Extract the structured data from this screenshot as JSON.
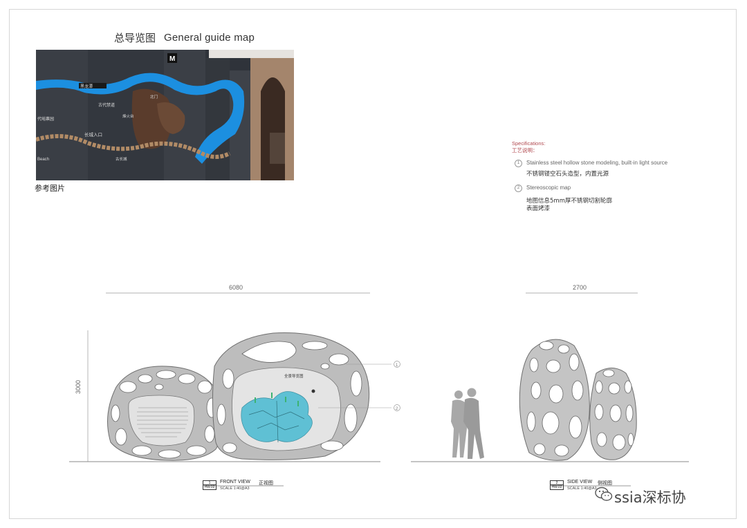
{
  "header": {
    "title_cn": "总导览图",
    "title_en": "General guide map"
  },
  "reference_photo": {
    "caption": "参考图片",
    "sign_labels": [
      "黑龙潭",
      "古代禁道",
      "代峪禀园",
      "长城入口",
      "Beach",
      "古长城",
      "北门",
      "烽火台"
    ],
    "colors": {
      "water": "#1c8fe0",
      "panel": "#33373e",
      "wall": "#a07a5e"
    }
  },
  "specifications": {
    "heading_en": "Specifications:",
    "heading_cn": "工艺说明：",
    "items": [
      {
        "num": "1",
        "text_en": "Stainless steel hollow stone modeling, built-in light source",
        "text_cn": [
          "不锈钢镂空石头造型，内置光源"
        ]
      },
      {
        "num": "2",
        "text_en": "Stereoscopic map",
        "text_cn": [
          "地图信息5mm厚不锈钢切割轮廓",
          "表面烤漆"
        ]
      }
    ]
  },
  "front_view": {
    "width_dim": "6080",
    "height_dim": "3000",
    "callouts": [
      "1",
      "2"
    ],
    "map_title": "全景导览图",
    "label_num": "1",
    "label_code": "HW.02",
    "label_en": "FRONT VIEW",
    "label_cn": "正视图",
    "scale": "SCALE 1:40@A3"
  },
  "side_view": {
    "width_dim": "2700",
    "label_num": "2",
    "label_code": "HW.02",
    "label_en": "SIDE VIEW",
    "label_cn": "侧视图",
    "scale": "SCALE 1:40@A3"
  },
  "watermark": {
    "text": "ssia深标协",
    "icon": "wechat-icon"
  },
  "colors": {
    "stone": "#bdbdbd",
    "stone_edge": "#6e6e6e",
    "map_blue": "#5fc0d4",
    "spec_red": "#b0474d"
  }
}
